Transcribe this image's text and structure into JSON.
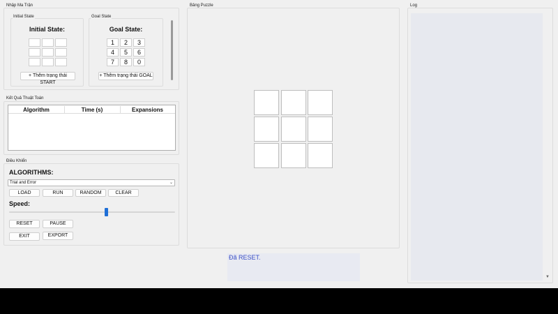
{
  "input_panel": {
    "title": "Nhập Ma Trận",
    "initial_group": "Initial State",
    "initial_heading": "Initial State:",
    "add_start_button": "+ Thêm trạng thái START",
    "goal_group": "Goal State",
    "goal_heading": "Goal State:",
    "goal_values": [
      "1",
      "2",
      "3",
      "4",
      "5",
      "6",
      "7",
      "8",
      "0"
    ],
    "add_goal_button": "+ Thêm trạng thái GOAL"
  },
  "results_panel": {
    "title": "Kết Quả Thuật Toán",
    "columns": [
      "Algorithm",
      "Time (s)",
      "Expansions"
    ]
  },
  "control_panel": {
    "title": "Điều Khiển",
    "algorithms_label": "ALGORITHMS:",
    "algorithm_selected": "Trial and Error",
    "load": "LOAD",
    "run": "RUN",
    "random": "RANDOM",
    "clear": "CLEAR",
    "speed_label": "Speed:",
    "speed_value": 0.59,
    "reset": "RESET",
    "pause": "PAUSE",
    "exit": "EXIT",
    "export": "EXPORT"
  },
  "puzzle_panel": {
    "title": "Bảng Puzzle"
  },
  "status": {
    "message": "Đã RESET."
  },
  "log_panel": {
    "title": "Log"
  },
  "colors": {
    "accent": "#1f6fd6",
    "status_text": "#3a4fc7",
    "status_bg": "#e8eaf2",
    "log_bg": "#e7e9ef"
  }
}
